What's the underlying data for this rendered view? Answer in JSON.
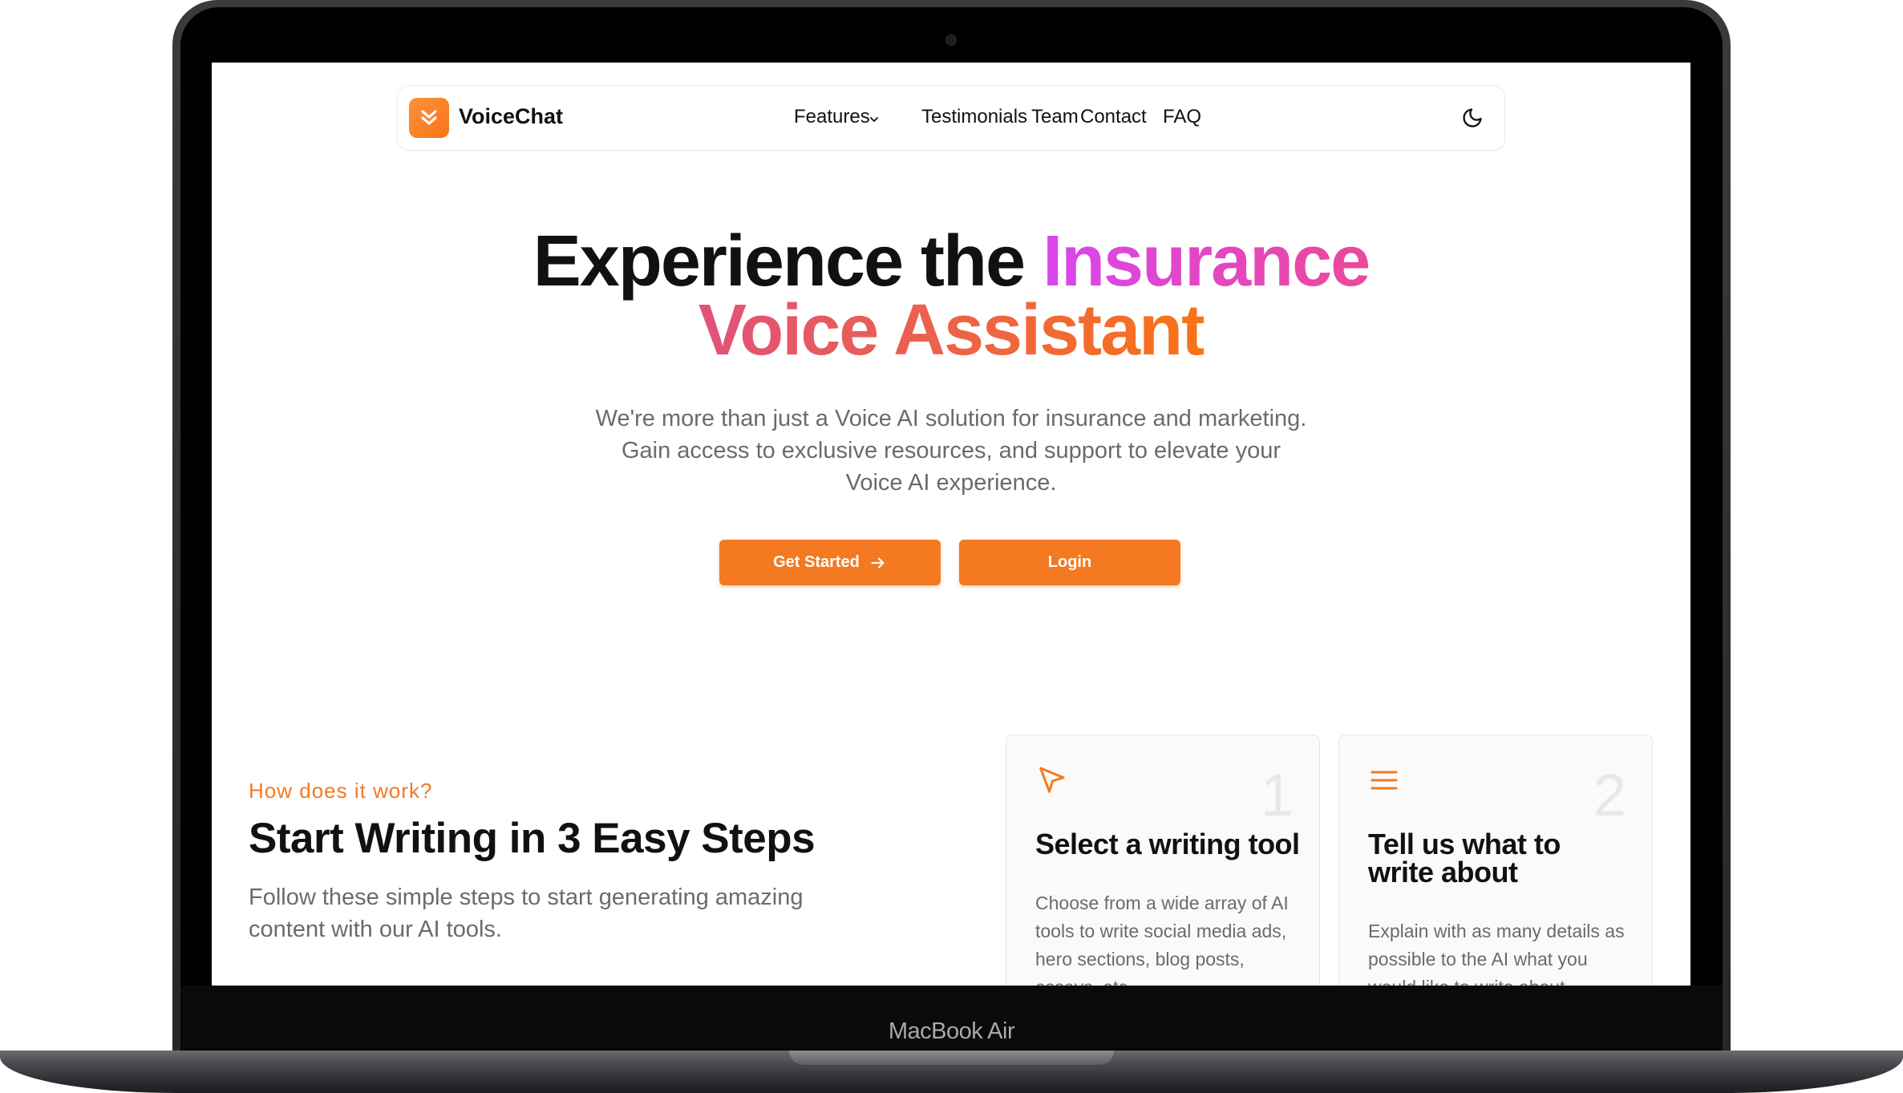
{
  "device": {
    "label": "MacBook Air"
  },
  "brand": {
    "name": "VoiceChat",
    "accent": "#f47920"
  },
  "nav": {
    "features": "Features",
    "testimonials": "Testimonials",
    "team": "Team",
    "contact": "Contact",
    "faq": "FAQ"
  },
  "hero": {
    "title_part1": "Experience the ",
    "title_highlight1": "Insurance",
    "title_highlight2": "Voice Assistant",
    "subtitle": "We're more than just a Voice AI solution for insurance and marketing. Gain access to exclusive resources, and support to elevate your Voice AI experience.",
    "get_started": "Get Started",
    "login": "Login"
  },
  "how": {
    "eyebrow": "How does it work?",
    "title": "Start Writing in 3 Easy Steps",
    "description": "Follow these simple steps to start generating amazing content with our AI tools."
  },
  "steps": [
    {
      "number": "1",
      "icon": "cursor-arrow-icon",
      "title": "Select a writing tool",
      "description": "Choose from a wide array of AI tools to write social media ads, hero sections, blog posts, essays, etc."
    },
    {
      "number": "2",
      "icon": "menu-lines-icon",
      "title": "Tell us what to write about",
      "description": "Explain with as many details as possible to the AI what you would like to write about."
    }
  ]
}
